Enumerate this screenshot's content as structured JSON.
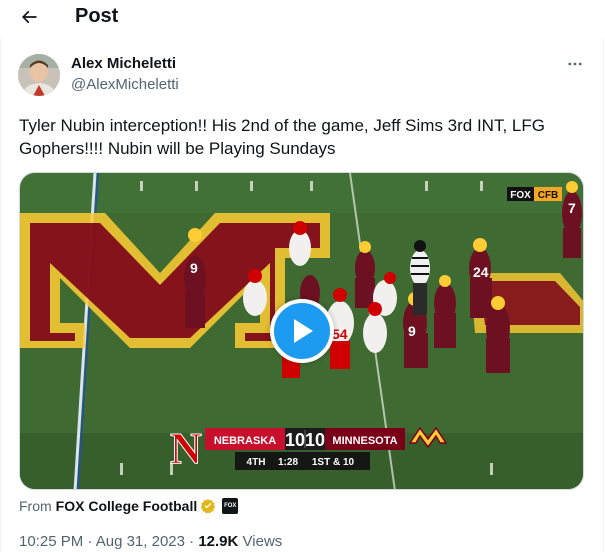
{
  "header": {
    "title": "Post",
    "back_icon": "arrow-left-icon"
  },
  "author": {
    "name": "Alex Micheletti",
    "handle": "@AlexMicheletti"
  },
  "tweet": {
    "text": "Tyler Nubin interception!! His 2nd of the game, Jeff Sims 3rd INT, LFG Gophers!!!! Nubin will be Playing Sundays"
  },
  "video": {
    "network_badge": {
      "fox": "FOX",
      "cfb": "CFB"
    },
    "scorebug": {
      "home_team": "NEBRASKA",
      "home_score": "10",
      "away_score": "10",
      "away_team": "MINNESOTA",
      "quarter": "4TH",
      "clock": "1:28",
      "down_distance": "1ST & 10"
    },
    "jersey_numbers": [
      "9",
      "24",
      "7",
      "54",
      "9"
    ],
    "play_icon": "play-icon"
  },
  "attribution": {
    "from_label": "From",
    "source": "FOX College Football",
    "logo_text": "FOX"
  },
  "meta": {
    "time": "10:25 PM",
    "date": "Aug 31, 2023",
    "views_count": "12.9K",
    "views_label": "Views",
    "separator": "·"
  },
  "colors": {
    "accent": "#1d9bf0",
    "text_primary": "#0f1419",
    "text_secondary": "#536471",
    "gophers_maroon": "#7a0019",
    "gophers_gold": "#ffcc33",
    "nebraska_red": "#d00000",
    "field_green": "#3f6b32",
    "verified_gold": "#e2b719"
  }
}
